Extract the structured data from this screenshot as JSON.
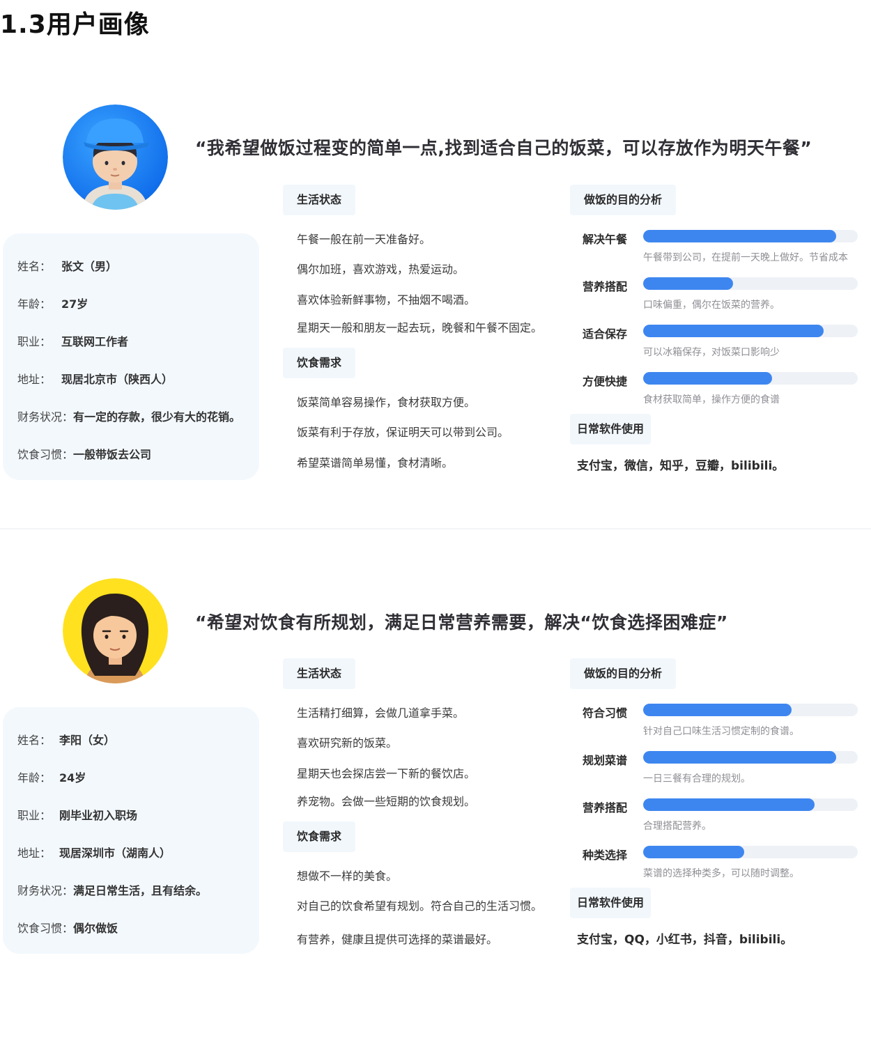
{
  "page_title": "1.3用户画像",
  "labels": {
    "name": "姓名：",
    "age": "年龄：",
    "job": "职业：",
    "address": "地址：",
    "finance": "财务状况：",
    "diet": "饮食习惯："
  },
  "sections": {
    "life": "生活状态",
    "needs": "饮食需求",
    "analysis": "做饭的目的分析",
    "apps": "日常软件使用"
  },
  "colors": {
    "bar_fill": "#3d86f0",
    "bar_track": "#eef1f5",
    "card_bg": "#f3f8fd"
  },
  "personas": [
    {
      "avatar_icon": "boy-blue-cap-avatar-icon",
      "quote": "“我希望做饭过程变的简单一点,找到适合自己的饭菜，可以存放作为明天午餐”",
      "info": {
        "name": "张文（男）",
        "age": "27岁",
        "job": "互联网工作者",
        "address": "现居北京市（陕西人）",
        "finance": "有一定的存款，很少有大的花销。",
        "diet": "一般带饭去公司"
      },
      "life": [
        "午餐一般在前一天准备好。",
        "偶尔加班，喜欢游戏，热爱运动。",
        "喜欢体验新鲜事物，不抽烟不喝酒。",
        "星期天一般和朋友一起去玩，晚餐和午餐不固定。"
      ],
      "needs": [
        "饭菜简单容易操作，食材获取方便。",
        "饭菜有利于存放，保证明天可以带到公司。",
        "希望菜谱简单易懂，食材清晰。"
      ],
      "analysis": [
        {
          "label": "解决午餐",
          "level": 0.9,
          "desc": "午餐带到公司，在提前一天晚上做好。节省成本"
        },
        {
          "label": "营养搭配",
          "level": 0.42,
          "desc": "口味偏重，偶尔在饭菜的营养。"
        },
        {
          "label": "适合保存",
          "level": 0.84,
          "desc": "可以冰箱保存，对饭菜口影响少"
        },
        {
          "label": "方便快捷",
          "level": 0.6,
          "desc": "食材获取简单，操作方便的食谱"
        }
      ],
      "apps": "支付宝，微信，知乎，豆瓣，bilibili。"
    },
    {
      "avatar_icon": "girl-yellow-bg-avatar-icon",
      "quote": "“希望对饮食有所规划，满足日常营养需要，解决“饮食选择困难症”",
      "info": {
        "name": "李阳（女）",
        "age": "24岁",
        "job": "刚毕业初入职场",
        "address": "现居深圳市（湖南人）",
        "finance": "满足日常生活，且有结余。",
        "diet": "偶尔做饭"
      },
      "life": [
        "生活精打细算，会做几道拿手菜。",
        "喜欢研究新的饭菜。",
        "星期天也会探店尝一下新的餐饮店。",
        "养宠物。会做一些短期的饮食规划。"
      ],
      "needs": [
        "想做不一样的美食。",
        "对自己的饮食希望有规划。符合自己的生活习惯。",
        "有营养，健康且提供可选择的菜谱最好。"
      ],
      "analysis": [
        {
          "label": "符合习惯",
          "level": 0.69,
          "desc": "针对自己口味生活习惯定制的食谱。"
        },
        {
          "label": "规划菜谱",
          "level": 0.9,
          "desc": "一日三餐有合理的规划。"
        },
        {
          "label": "营养搭配",
          "level": 0.8,
          "desc": "合理搭配营养。"
        },
        {
          "label": "种类选择",
          "level": 0.47,
          "desc": "菜谱的选择种类多，可以随时调整。"
        }
      ],
      "apps": "支付宝，QQ，小红书，抖音，bilibili。"
    }
  ]
}
